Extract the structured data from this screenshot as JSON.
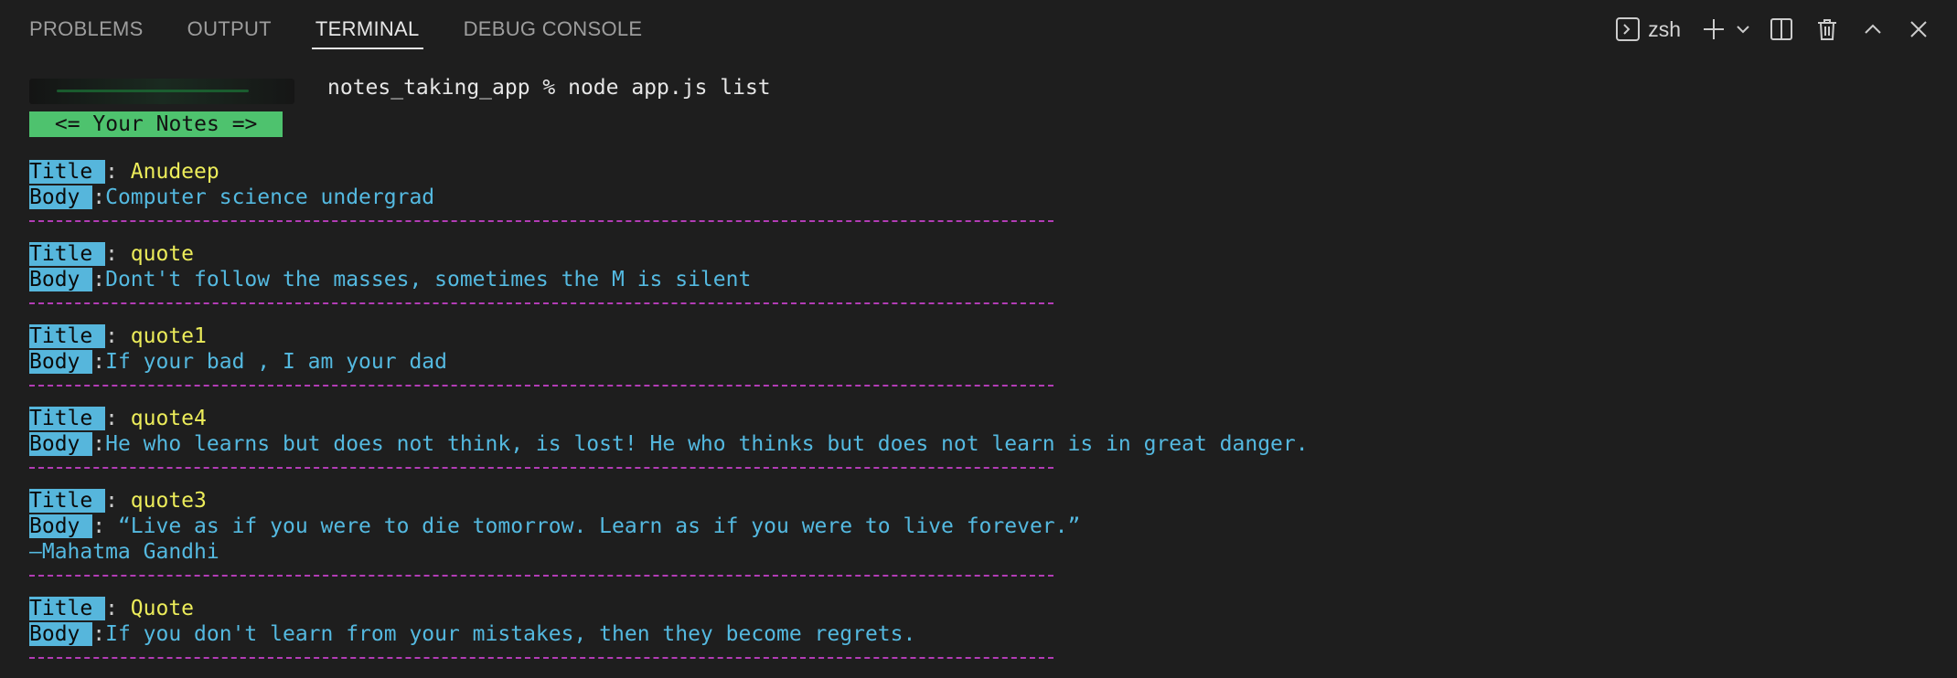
{
  "tabs": [
    {
      "label": "PROBLEMS",
      "active": false
    },
    {
      "label": "OUTPUT",
      "active": false
    },
    {
      "label": "TERMINAL",
      "active": true
    },
    {
      "label": "DEBUG CONSOLE",
      "active": false
    }
  ],
  "actions": {
    "shell_name": "zsh",
    "icons": [
      "terminal-icon",
      "plus-icon",
      "chevron-down-icon",
      "split-icon",
      "trash-icon",
      "chevron-up-icon",
      "close-icon"
    ]
  },
  "terminal": {
    "prompt": "notes_taking_app % node app.js list",
    "banner": " <= Your Notes => ",
    "notes": [
      {
        "title_label": "Title ",
        "title_sep": ": ",
        "title": "Anudeep",
        "body_label": "Body ",
        "body_sep": ":",
        "body": [
          "Computer science undergrad"
        ]
      },
      {
        "title_label": "Title ",
        "title_sep": ": ",
        "title": "quote",
        "body_label": "Body ",
        "body_sep": ":",
        "body": [
          "Dont't follow the masses, sometimes the M is silent"
        ]
      },
      {
        "title_label": "Title ",
        "title_sep": ": ",
        "title": "quote1",
        "body_label": "Body ",
        "body_sep": ":",
        "body": [
          "If your bad , I am your dad"
        ]
      },
      {
        "title_label": "Title ",
        "title_sep": ": ",
        "title": "quote4",
        "body_label": "Body ",
        "body_sep": ":",
        "body": [
          "He who learns but does not think, is lost! He who thinks but does not learn is in great danger."
        ]
      },
      {
        "title_label": "Title ",
        "title_sep": ": ",
        "title": "quote3",
        "body_label": "Body ",
        "body_sep": ": ",
        "body": [
          "“Live as if you were to die tomorrow. Learn as if you were to live forever.”",
          "―Mahatma Gandhi"
        ]
      },
      {
        "title_label": "Title ",
        "title_sep": ": ",
        "title": "Quote",
        "body_label": "Body ",
        "body_sep": ":",
        "body": [
          "If you don't learn from your mistakes, then they become regrets."
        ]
      }
    ]
  }
}
